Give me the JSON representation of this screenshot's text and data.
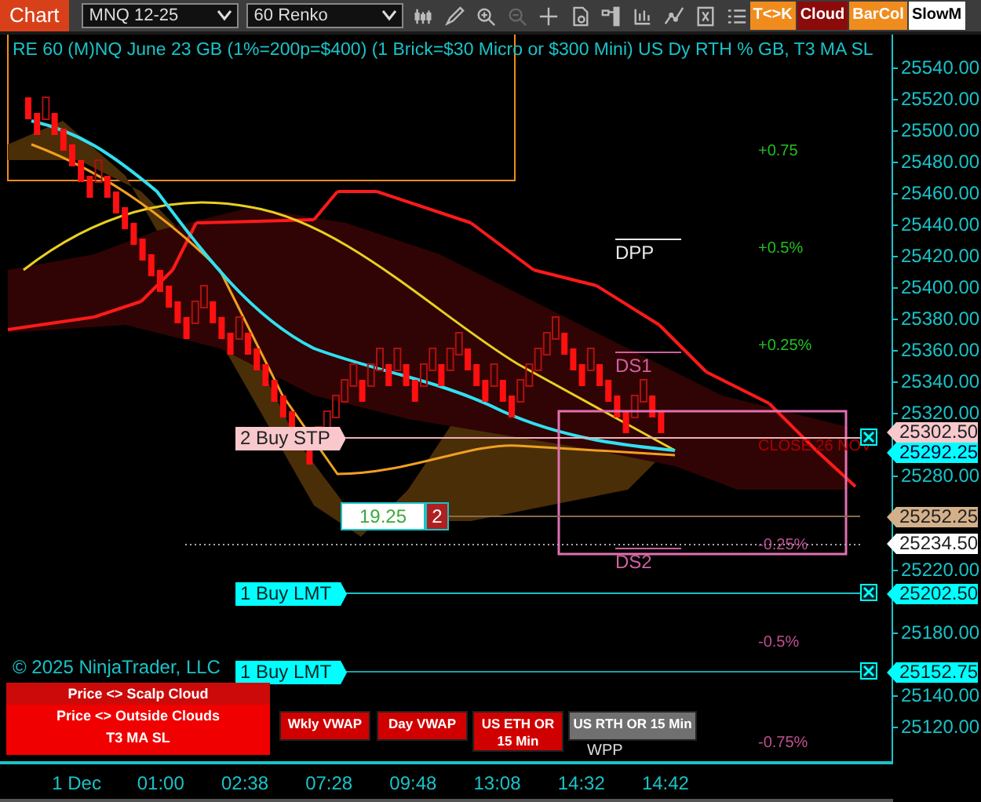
{
  "toolbar": {
    "title": "Chart",
    "instrument": "MNQ 12-25",
    "interval": "60 Renko",
    "buttons": [
      {
        "label": "T<>K",
        "color": "#f08c1e"
      },
      {
        "label": "Cloud",
        "color": "#8b0a0a"
      },
      {
        "label": "BarCol",
        "color": "#f08c1e"
      },
      {
        "label": "SlowM",
        "color": "#ffffff"
      }
    ]
  },
  "chart": {
    "title": "RE 60 (M)NQ June 23 GB (1%=200p=$400) (1 Brick=$30 Micro or $300 Mini) US Dy RTH % GB, T3 MA SL",
    "levels": [
      {
        "label": "DPP",
        "kind": "pivot"
      },
      {
        "label": "DS1",
        "kind": "support"
      },
      {
        "label": "DS2",
        "kind": "support"
      }
    ],
    "percent_labels": [
      {
        "label": "+0.75",
        "kind": "up"
      },
      {
        "label": "+0.5%",
        "kind": "up"
      },
      {
        "label": "+0.25%",
        "kind": "up"
      },
      {
        "label": "-0.25%",
        "kind": "down"
      },
      {
        "label": "-0.5%",
        "kind": "down"
      },
      {
        "label": "-0.75%",
        "kind": "down"
      }
    ],
    "note": "CLOSE 26 NOV",
    "orders": [
      {
        "label": "2 Buy STP",
        "kind": "stop"
      },
      {
        "label": "1 Buy LMT",
        "kind": "limit"
      },
      {
        "label": "1 Buy LMT",
        "kind": "limit"
      }
    ],
    "position": {
      "pnl": "19.25",
      "quantity": "2"
    },
    "alerts": [
      "Price <> Scalp Cloud",
      "Price <> Outside Clouds",
      "T3 MA SL"
    ],
    "copyright": "© 2025 NinjaTrader, LLC",
    "indicator_buttons": [
      {
        "label": "Wkly VWAP",
        "active": true
      },
      {
        "label": "Day VWAP",
        "active": true
      },
      {
        "label": "US ETH OR 15 Min",
        "active": true
      },
      {
        "label": "US RTH OR 15 Min",
        "active": false
      }
    ],
    "wpp_label": "WPP"
  },
  "price_axis": {
    "ticks": [
      "25540.00",
      "25520.00",
      "25500.00",
      "25480.00",
      "25460.00",
      "25440.00",
      "25420.00",
      "25400.00",
      "25380.00",
      "25360.00",
      "25340.00",
      "25320.00",
      "25280.00",
      "25220.00",
      "25180.00",
      "25140.00",
      "25120.00"
    ],
    "markers": [
      {
        "label": "25302.50",
        "kind": "stop"
      },
      {
        "label": "25292.25",
        "kind": "ma"
      },
      {
        "label": "25252.25",
        "kind": "average"
      },
      {
        "label": "25234.50",
        "kind": "last"
      },
      {
        "label": "25202.50",
        "kind": "limit"
      },
      {
        "label": "25152.75",
        "kind": "limit"
      }
    ]
  },
  "time_axis": [
    "1 Dec",
    "01:00",
    "02:38",
    "07:28",
    "09:48",
    "13:08",
    "14:32",
    "14:42"
  ]
}
